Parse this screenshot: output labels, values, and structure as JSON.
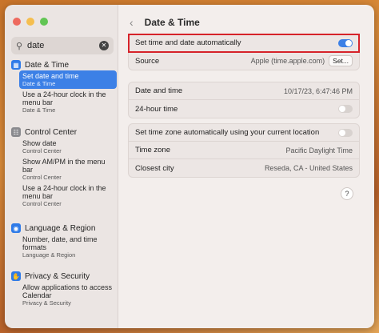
{
  "search": {
    "query": "date",
    "clear_label": "✕"
  },
  "sidebar": {
    "sections": [
      {
        "title": "Date & Time",
        "icon": "calendar-icon",
        "items": [
          {
            "main": "Set date and time",
            "sub": "Date & Time",
            "selected": true
          },
          {
            "main": "Use a 24-hour clock in the menu bar",
            "sub": "Date & Time"
          }
        ]
      },
      {
        "title": "Control Center",
        "icon": "control-center-icon",
        "items": [
          {
            "main": "Show date",
            "sub": "Control Center"
          },
          {
            "main": "Show AM/PM in the menu bar",
            "sub": "Control Center"
          },
          {
            "main": "Use a 24-hour clock in the menu bar",
            "sub": "Control Center"
          }
        ]
      },
      {
        "title": "Language & Region",
        "icon": "globe-icon",
        "items": [
          {
            "main": "Number, date, and time formats",
            "sub": "Language & Region"
          }
        ]
      },
      {
        "title": "Privacy & Security",
        "icon": "hand-icon",
        "items": [
          {
            "main": "Allow applications to access Calendar",
            "sub": "Privacy & Security"
          }
        ]
      }
    ]
  },
  "header": {
    "back": "‹",
    "title": "Date & Time"
  },
  "groups": {
    "auto": {
      "set_auto_label": "Set time and date automatically",
      "set_auto_on": true,
      "source_label": "Source",
      "source_value": "Apple (time.apple.com)",
      "set_button": "Set..."
    },
    "datetime": {
      "date_time_label": "Date and time",
      "date_time_value": "10/17/23, 6:47:46 PM",
      "clock24_label": "24-hour time",
      "clock24_on": false
    },
    "timezone": {
      "tz_auto_label": "Set time zone automatically using your current location",
      "tz_auto_on": false,
      "time_zone_label": "Time zone",
      "time_zone_value": "Pacific Daylight Time",
      "closest_city_label": "Closest city",
      "closest_city_value": "Reseda, CA - United States"
    }
  },
  "help_label": "?"
}
